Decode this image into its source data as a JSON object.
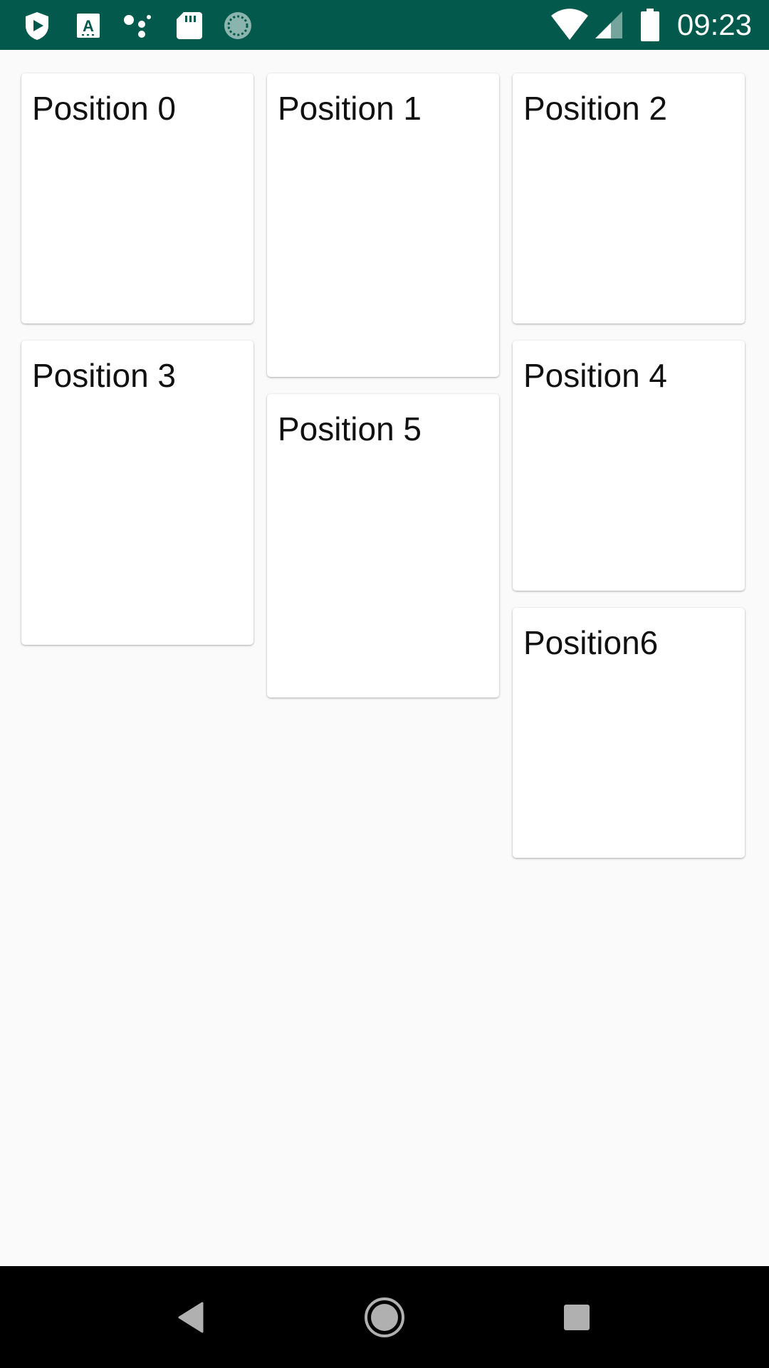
{
  "status_bar": {
    "time": "09:23",
    "background_color": "#02594c",
    "left_icons": [
      "play-protect-icon",
      "keyboard-icon",
      "assistant-dots-icon",
      "sd-card-icon",
      "sync-circle-icon"
    ],
    "right_icons": [
      "wifi-icon",
      "cell-signal-icon",
      "battery-icon"
    ]
  },
  "grid": {
    "items": [
      {
        "label": "Position 0"
      },
      {
        "label": "Position 1"
      },
      {
        "label": "Position 2"
      },
      {
        "label": "Position 3"
      },
      {
        "label": "Position 5"
      },
      {
        "label": "Position 4"
      },
      {
        "label": "Position6"
      }
    ]
  },
  "nav_bar": {
    "buttons": [
      "back-icon",
      "home-icon",
      "recents-icon"
    ]
  }
}
